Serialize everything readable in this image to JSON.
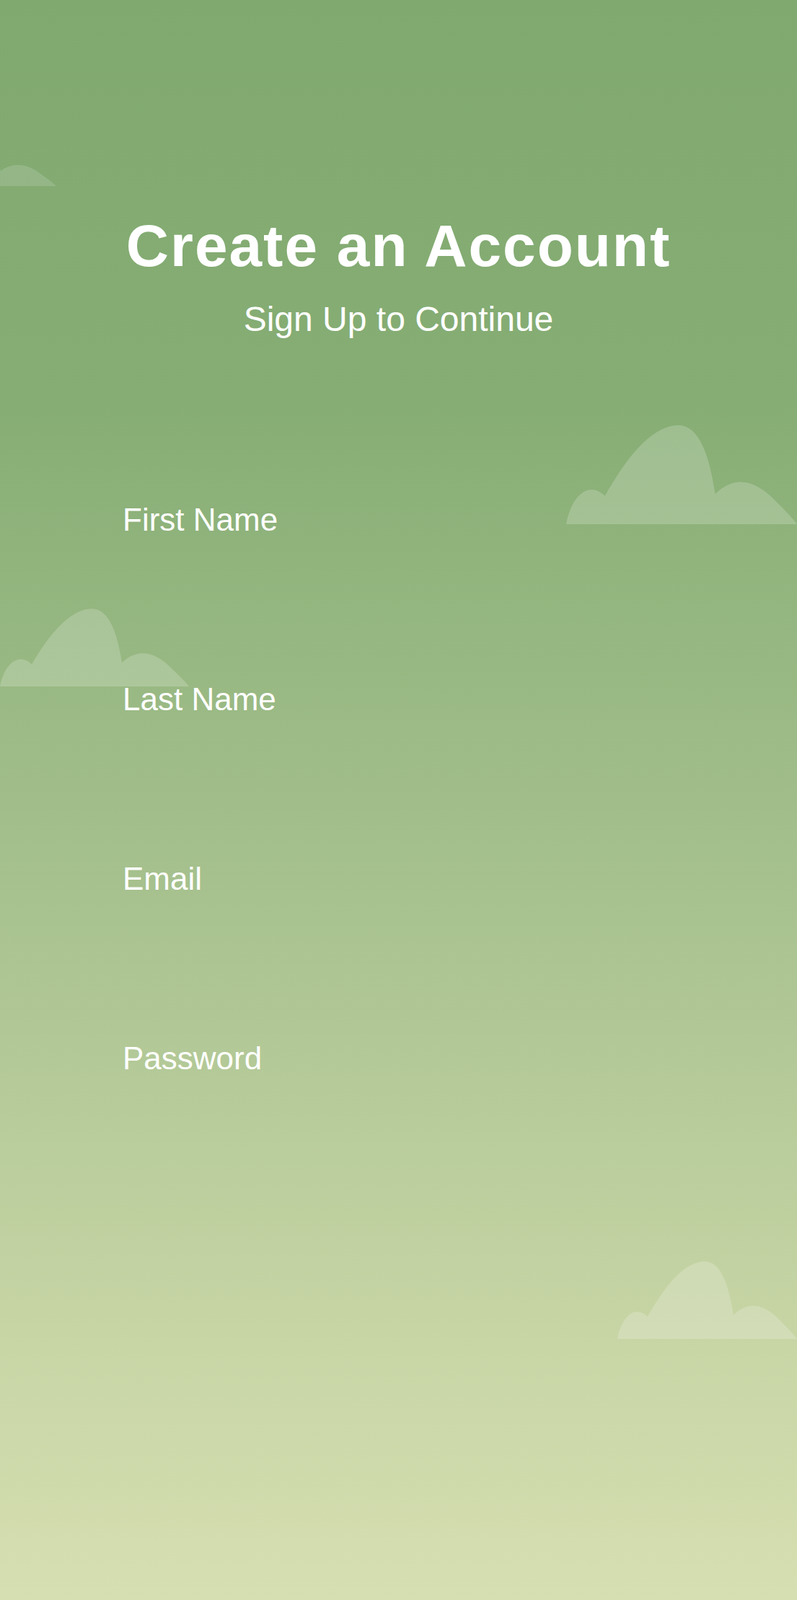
{
  "header": {
    "title": "Create an Account",
    "subtitle": "Sign Up to Continue"
  },
  "fields": [
    {
      "label": "First Name"
    },
    {
      "label": "Last Name"
    },
    {
      "label": "Email"
    },
    {
      "label": "Password"
    }
  ]
}
